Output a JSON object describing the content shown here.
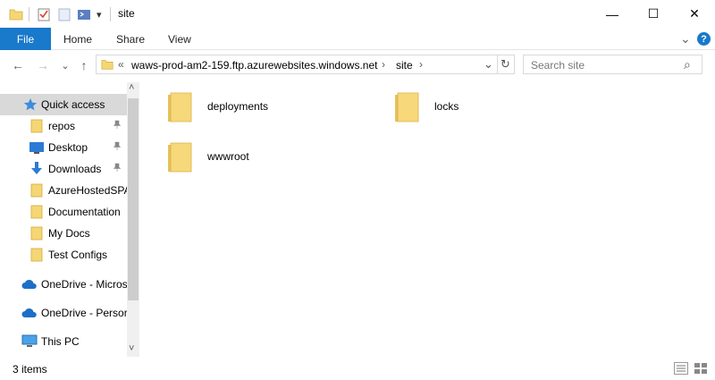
{
  "window": {
    "title": "site",
    "dropdown_glyph": "▾",
    "minimize_glyph": "—",
    "maximize_glyph": "☐",
    "close_glyph": "✕"
  },
  "ribbon": {
    "file": "File",
    "tabs": [
      "Home",
      "Share",
      "View"
    ],
    "collapse_glyph": "⌄",
    "help_glyph": "?"
  },
  "navigation": {
    "back_glyph": "←",
    "forward_glyph": "→",
    "recent_glyph": "⌄",
    "up_glyph": "↑",
    "address_prefix": "«",
    "path": [
      "waws-prod-am2-159.ftp.azurewebsites.windows.net",
      "site"
    ],
    "separator": "›",
    "address_dropdown_glyph": "⌄",
    "refresh_glyph": "↻",
    "search_placeholder": "Search site",
    "search_glyph": "⌕"
  },
  "nav_pane": {
    "pin_glyph": "📌",
    "scroll_up_glyph": "˄",
    "scroll_down_glyph": "˅",
    "items": [
      {
        "label": "Quick access",
        "icon": "star-icon",
        "selected": true
      },
      {
        "label": "repos",
        "icon": "folder-icon",
        "pinned": true
      },
      {
        "label": "Desktop",
        "icon": "desktop-icon",
        "pinned": true
      },
      {
        "label": "Downloads",
        "icon": "download-icon",
        "pinned": true
      },
      {
        "label": "AzureHostedSPA",
        "icon": "folder-icon"
      },
      {
        "label": "Documentation",
        "icon": "folder-icon"
      },
      {
        "label": "My Docs",
        "icon": "folder-icon"
      },
      {
        "label": "Test Configs",
        "icon": "folder-icon"
      },
      {
        "label": "OneDrive - Micros",
        "icon": "cloud-icon"
      },
      {
        "label": "OneDrive - Persor",
        "icon": "cloud-icon"
      },
      {
        "label": "This PC",
        "icon": "pc-icon"
      }
    ]
  },
  "content": {
    "items": [
      {
        "name": "deployments",
        "icon": "folder-icon"
      },
      {
        "name": "locks",
        "icon": "folder-icon"
      },
      {
        "name": "wwwroot",
        "icon": "folder-icon"
      }
    ]
  },
  "status": {
    "count": "3 items"
  },
  "colors": {
    "accent": "#1979ca",
    "folder": "#f5d675",
    "selection": "#cce8ff"
  }
}
